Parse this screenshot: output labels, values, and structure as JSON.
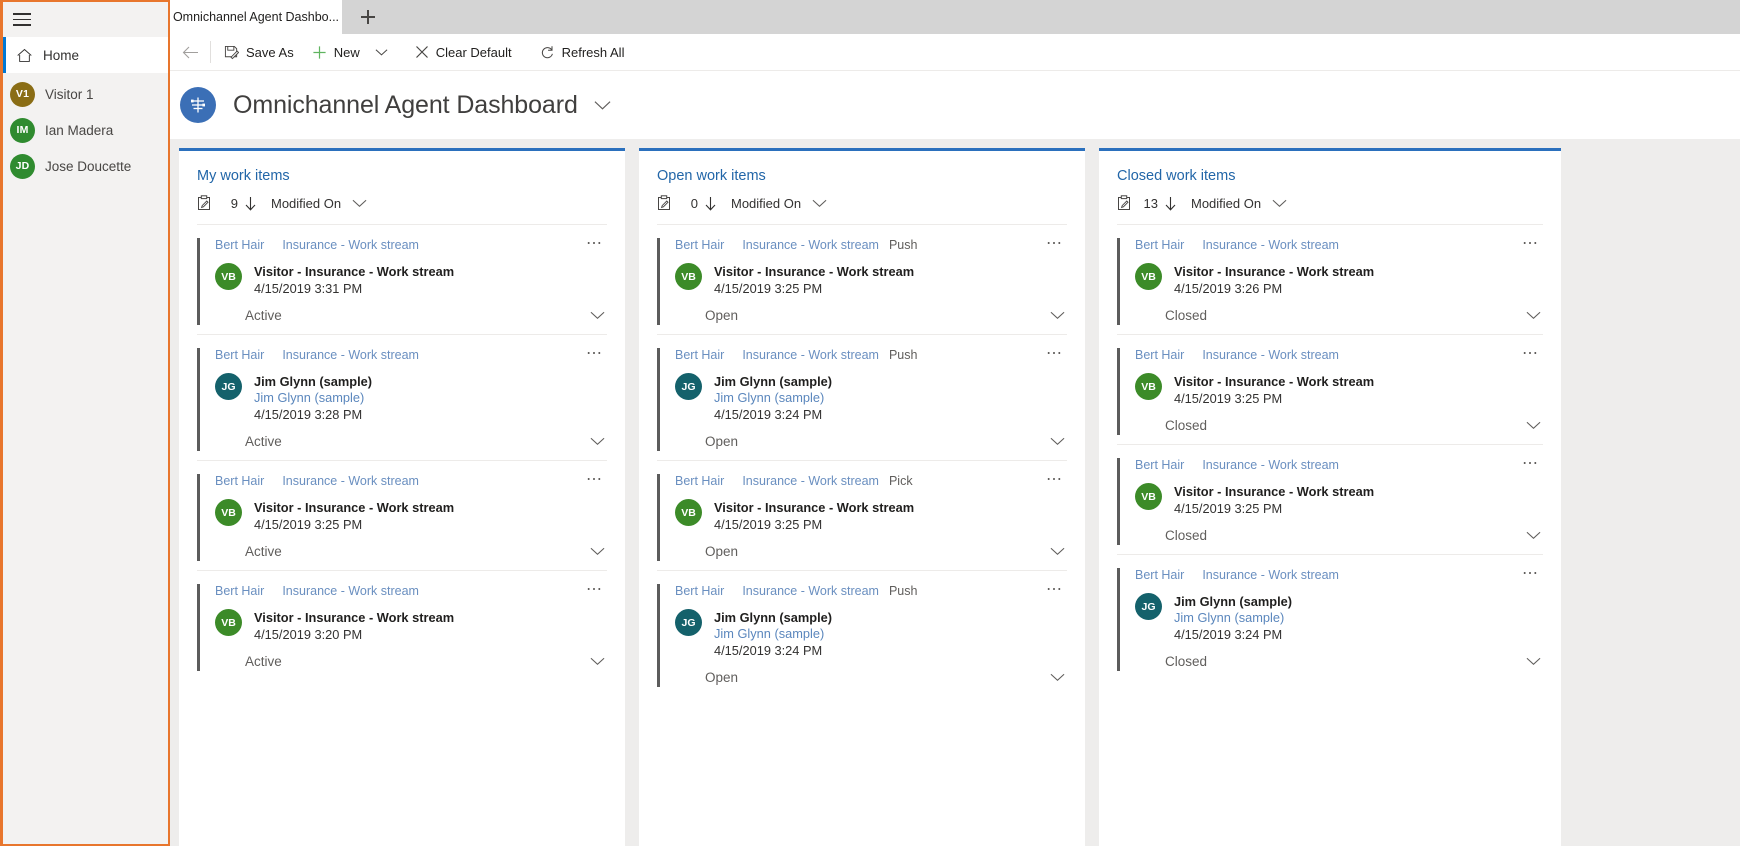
{
  "sidebar": {
    "hamburger_icon": "hamburger-menu-icon",
    "home": {
      "label": "Home",
      "icon": "home-icon"
    },
    "items": [
      {
        "initials": "V1",
        "name": "Visitor 1",
        "color": "#8a6d15"
      },
      {
        "initials": "IM",
        "name": "Ian Madera",
        "color": "#2f8b2f"
      },
      {
        "initials": "JD",
        "name": "Jose Doucette",
        "color": "#2f8b2f"
      }
    ]
  },
  "tabstrip": {
    "active_tab": "Omnichannel Agent Dashbo...",
    "new_tab_icon": "plus-icon"
  },
  "commandbar": {
    "back_icon": "back-arrow-icon",
    "buttons": [
      {
        "label": "Save As",
        "icon": "save-as-icon"
      },
      {
        "label": "New",
        "icon": "plus-icon",
        "caret": true
      },
      {
        "label": "Clear Default",
        "icon": "close-x-icon"
      },
      {
        "label": "Refresh All",
        "icon": "refresh-icon"
      }
    ]
  },
  "header": {
    "app_icon": "omnichannel-icon",
    "title": "Omnichannel Agent Dashboard",
    "caret_icon": "chevron-down-icon",
    "accent_color": "#3b6fb6"
  },
  "board": {
    "columns": [
      {
        "title": "My work items",
        "count": "9",
        "sort_field": "Modified On",
        "count_icon": "clipboard-icon",
        "sort_arrow_icon": "arrow-down-icon",
        "sort_caret_icon": "chevron-down-icon",
        "cards": [
          {
            "owner": "Bert Hair",
            "stream": "Insurance - Work stream",
            "mode": "",
            "initials": "VB",
            "avatar_color": "#3c8b28",
            "line1": "Visitor - Insurance - Work stream",
            "line2": "",
            "line3": "4/15/2019 3:31 PM",
            "status": "Active"
          },
          {
            "owner": "Bert Hair",
            "stream": "Insurance - Work stream",
            "mode": "",
            "initials": "JG",
            "avatar_color": "#14616b",
            "line1": "Jim Glynn (sample)",
            "line2": "Jim Glynn (sample)",
            "line3": "4/15/2019 3:28 PM",
            "status": "Active"
          },
          {
            "owner": "Bert Hair",
            "stream": "Insurance - Work stream",
            "mode": "",
            "initials": "VB",
            "avatar_color": "#3c8b28",
            "line1": "Visitor - Insurance - Work stream",
            "line2": "",
            "line3": "4/15/2019 3:25 PM",
            "status": "Active"
          },
          {
            "owner": "Bert Hair",
            "stream": "Insurance - Work stream",
            "mode": "",
            "initials": "VB",
            "avatar_color": "#3c8b28",
            "line1": "Visitor - Insurance - Work stream",
            "line2": "",
            "line3": "4/15/2019 3:20 PM",
            "status": "Active"
          }
        ]
      },
      {
        "title": "Open work items",
        "count": "0",
        "sort_field": "Modified On",
        "count_icon": "clipboard-icon",
        "sort_arrow_icon": "arrow-down-icon",
        "sort_caret_icon": "chevron-down-icon",
        "cards": [
          {
            "owner": "Bert Hair",
            "stream": "Insurance - Work stream",
            "mode": "Push",
            "initials": "VB",
            "avatar_color": "#3c8b28",
            "line1": "Visitor - Insurance - Work stream",
            "line2": "",
            "line3": "4/15/2019 3:25 PM",
            "status": "Open"
          },
          {
            "owner": "Bert Hair",
            "stream": "Insurance - Work stream",
            "mode": "Push",
            "initials": "JG",
            "avatar_color": "#14616b",
            "line1": "Jim Glynn (sample)",
            "line2": "Jim Glynn (sample)",
            "line3": "4/15/2019 3:24 PM",
            "status": "Open"
          },
          {
            "owner": "Bert Hair",
            "stream": "Insurance - Work stream",
            "mode": "Pick",
            "initials": "VB",
            "avatar_color": "#3c8b28",
            "line1": "Visitor - Insurance - Work stream",
            "line2": "",
            "line3": "4/15/2019 3:25 PM",
            "status": "Open"
          },
          {
            "owner": "Bert Hair",
            "stream": "Insurance - Work stream",
            "mode": "Push",
            "initials": "JG",
            "avatar_color": "#14616b",
            "line1": "Jim Glynn (sample)",
            "line2": "Jim Glynn (sample)",
            "line3": "4/15/2019 3:24 PM",
            "status": "Open"
          }
        ]
      },
      {
        "title": "Closed work items",
        "count": "13",
        "sort_field": "Modified On",
        "count_icon": "clipboard-icon",
        "sort_arrow_icon": "arrow-down-icon",
        "sort_caret_icon": "chevron-down-icon",
        "cards": [
          {
            "owner": "Bert Hair",
            "stream": "Insurance - Work stream",
            "mode": "",
            "initials": "VB",
            "avatar_color": "#3c8b28",
            "line1": "Visitor - Insurance - Work stream",
            "line2": "",
            "line3": "4/15/2019 3:26 PM",
            "status": "Closed"
          },
          {
            "owner": "Bert Hair",
            "stream": "Insurance - Work stream",
            "mode": "",
            "initials": "VB",
            "avatar_color": "#3c8b28",
            "line1": "Visitor - Insurance - Work stream",
            "line2": "",
            "line3": "4/15/2019 3:25 PM",
            "status": "Closed"
          },
          {
            "owner": "Bert Hair",
            "stream": "Insurance - Work stream",
            "mode": "",
            "initials": "VB",
            "avatar_color": "#3c8b28",
            "line1": "Visitor - Insurance - Work stream",
            "line2": "",
            "line3": "4/15/2019 3:25 PM",
            "status": "Closed"
          },
          {
            "owner": "Bert Hair",
            "stream": "Insurance - Work stream",
            "mode": "",
            "initials": "JG",
            "avatar_color": "#14616b",
            "line1": "Jim Glynn (sample)",
            "line2": "Jim Glynn (sample)",
            "line3": "4/15/2019 3:24 PM",
            "status": "Closed"
          }
        ]
      }
    ]
  }
}
